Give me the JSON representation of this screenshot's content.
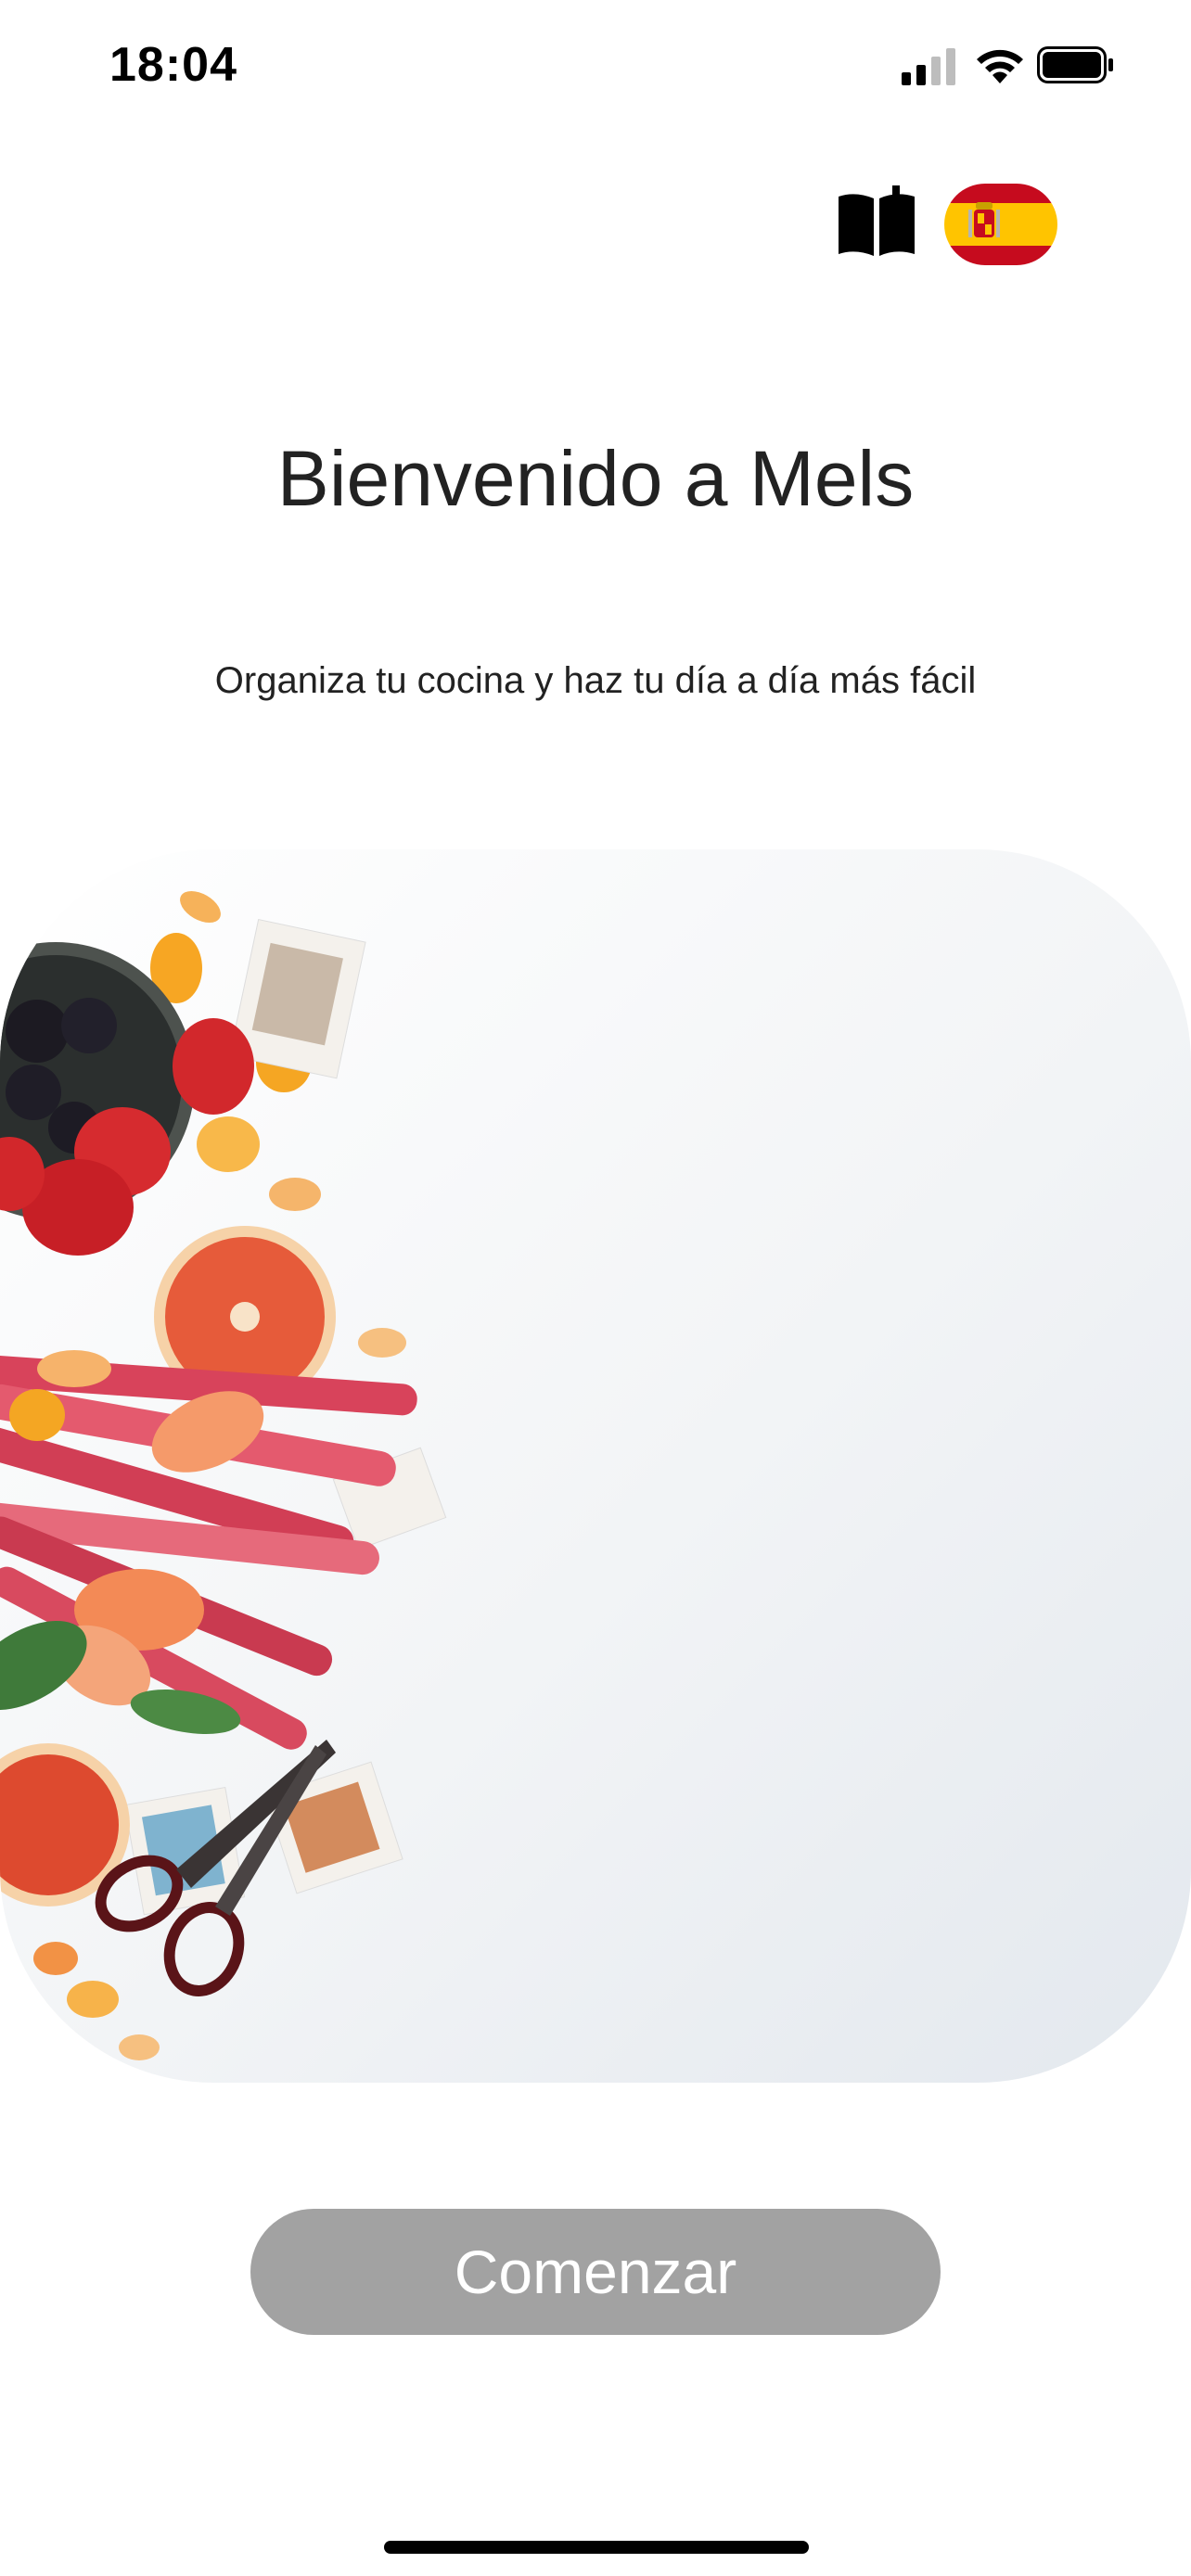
{
  "status_bar": {
    "time": "18:04",
    "icons": [
      "cellular-signal-icon",
      "wifi-icon",
      "battery-icon"
    ]
  },
  "header": {
    "guide_icon": "open-book-icon",
    "language_flag": "spain-flag-icon"
  },
  "welcome": {
    "title": "Bienvenido a Mels",
    "subtitle": "Organiza tu cocina y haz tu día a día más fácil"
  },
  "hero_image": {
    "subject": "fruits-and-vegetables-flatlay"
  },
  "actions": {
    "start_label": "Comenzar"
  },
  "colors": {
    "button_background": "#a2a2a2",
    "button_text": "#ffffff",
    "text": "#222222",
    "flag_red": "#c60b1e",
    "flag_yellow": "#ffc400"
  }
}
